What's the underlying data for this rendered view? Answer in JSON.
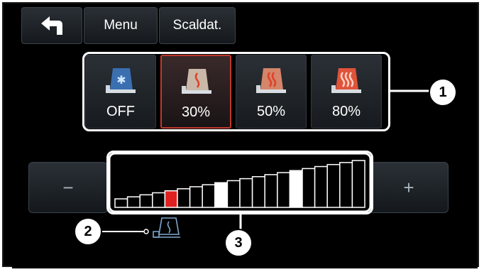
{
  "nav": {
    "back_icon": "back-arrow-icon",
    "menu_label": "Menu",
    "scaldat_label": "Scaldat."
  },
  "levels": [
    {
      "label": "OFF",
      "icon": "seat-cold-icon",
      "active": false
    },
    {
      "label": "30%",
      "icon": "seat-heat-low-icon",
      "active": true
    },
    {
      "label": "50%",
      "icon": "seat-heat-mid-icon",
      "active": false
    },
    {
      "label": "80%",
      "icon": "seat-heat-high-icon",
      "active": false
    }
  ],
  "stepper": {
    "minus_label": "−",
    "plus_label": "+",
    "bar_count": 20,
    "marked_red": [
      4
    ],
    "marked_white": [
      8,
      14
    ]
  },
  "callouts": [
    "1",
    "2",
    "3"
  ],
  "indicator_icon": "seat-heat-indicator-icon",
  "colors": {
    "active": "#c0392b",
    "selected_bar": "#e02020"
  }
}
